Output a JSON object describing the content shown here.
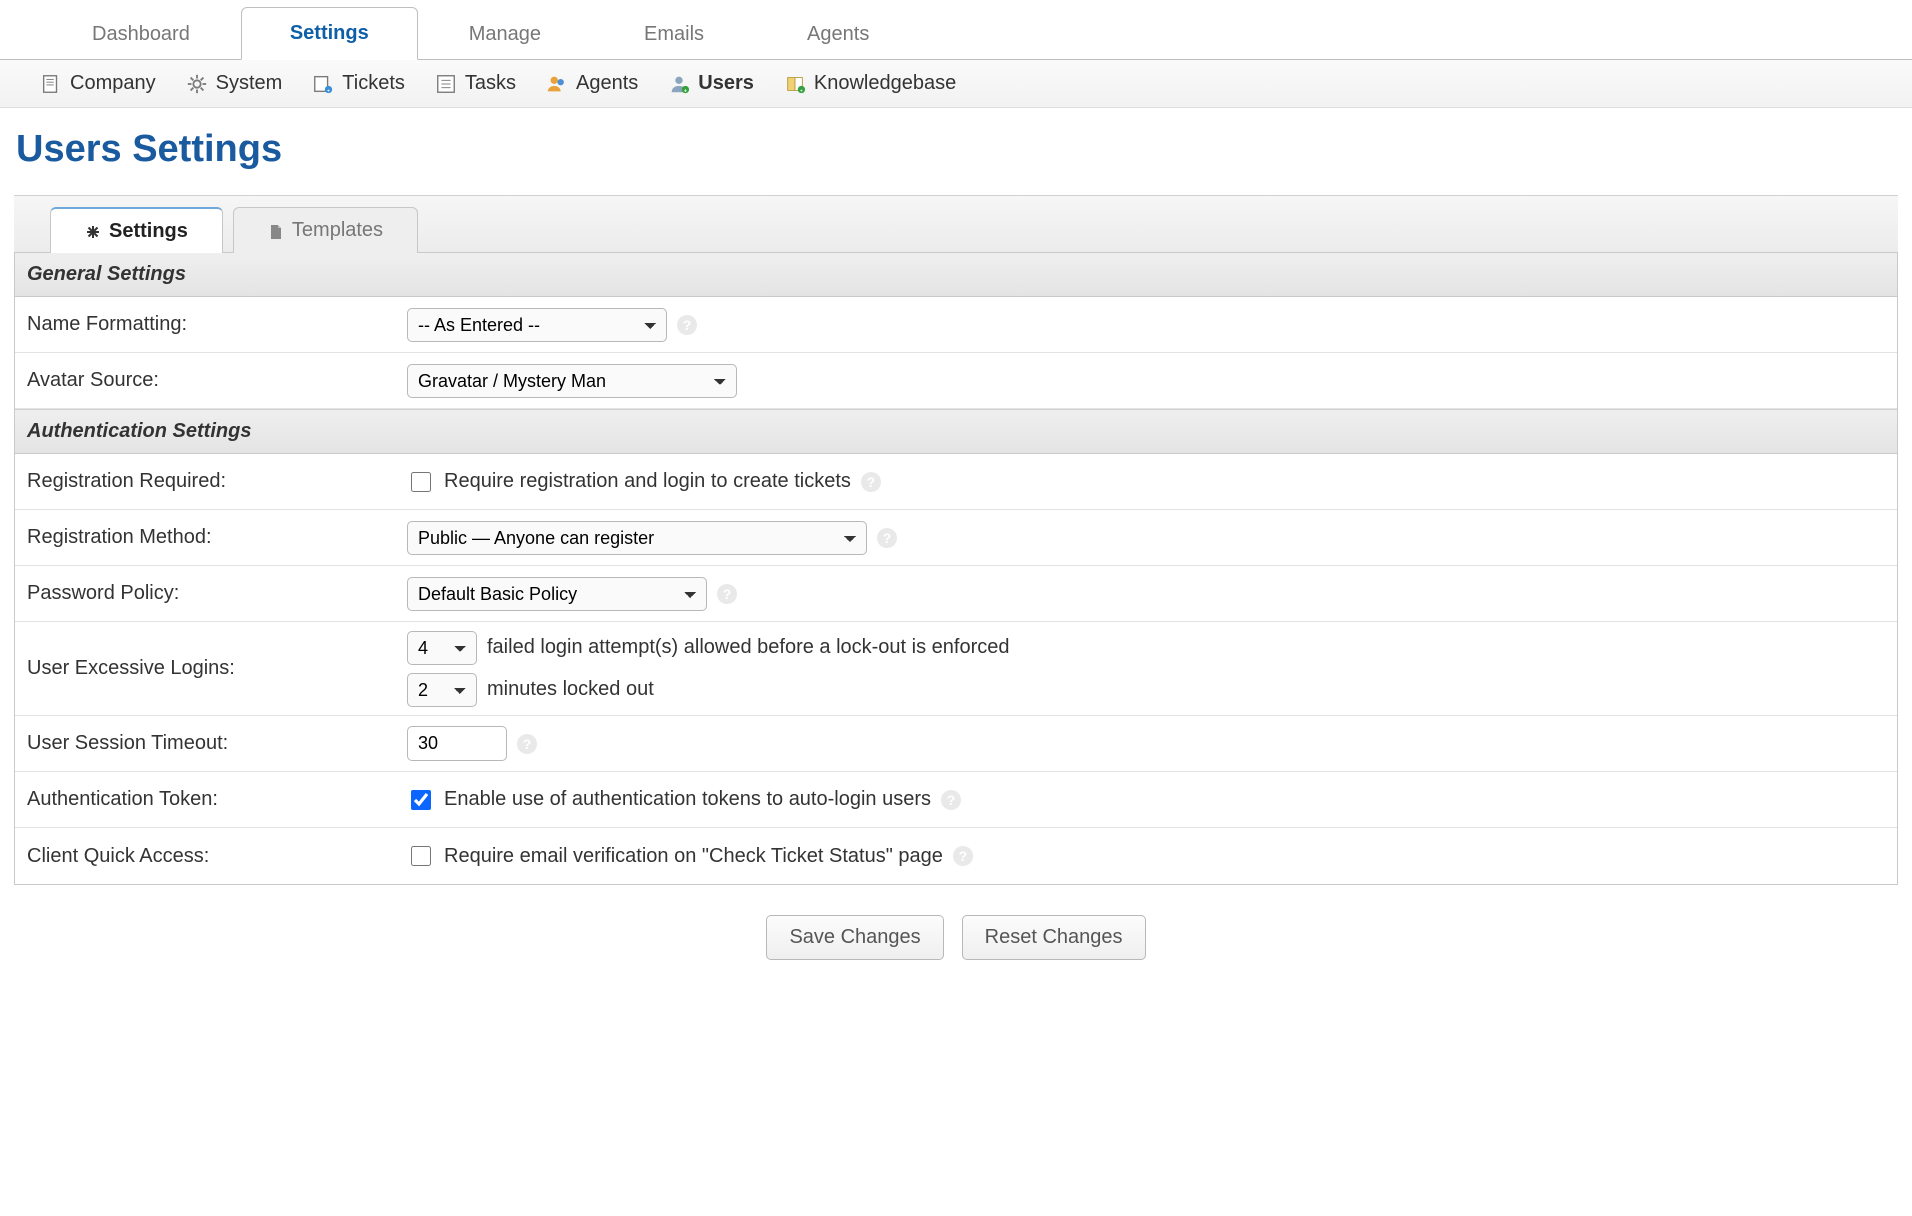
{
  "topnav": {
    "tabs": [
      {
        "label": "Dashboard",
        "active": false
      },
      {
        "label": "Settings",
        "active": true
      },
      {
        "label": "Manage",
        "active": false
      },
      {
        "label": "Emails",
        "active": false
      },
      {
        "label": "Agents",
        "active": false
      }
    ]
  },
  "subnav": {
    "items": [
      {
        "label": "Company",
        "active": false,
        "icon": "company-icon"
      },
      {
        "label": "System",
        "active": false,
        "icon": "gear-icon"
      },
      {
        "label": "Tickets",
        "active": false,
        "icon": "ticket-icon"
      },
      {
        "label": "Tasks",
        "active": false,
        "icon": "tasks-icon"
      },
      {
        "label": "Agents",
        "active": false,
        "icon": "agents-icon"
      },
      {
        "label": "Users",
        "active": true,
        "icon": "user-icon"
      },
      {
        "label": "Knowledgebase",
        "active": false,
        "icon": "book-icon"
      }
    ]
  },
  "page_title": "Users Settings",
  "content_tabs": [
    {
      "label": "Settings",
      "active": true,
      "icon": "asterisk-icon"
    },
    {
      "label": "Templates",
      "active": false,
      "icon": "file-icon"
    }
  ],
  "sections": {
    "general": {
      "header": "General Settings",
      "name_formatting": {
        "label": "Name Formatting:",
        "value": "-- As Entered --"
      },
      "avatar_source": {
        "label": "Avatar Source:",
        "value": "Gravatar / Mystery Man"
      }
    },
    "auth": {
      "header": "Authentication Settings",
      "registration_required": {
        "label": "Registration Required:",
        "checked": false,
        "text": "Require registration and login to create tickets"
      },
      "registration_method": {
        "label": "Registration Method:",
        "value": "Public — Anyone can register"
      },
      "password_policy": {
        "label": "Password Policy:",
        "value": "Default Basic Policy"
      },
      "excessive_logins": {
        "label": "User Excessive Logins:",
        "attempts": "4",
        "attempts_text": "failed login attempt(s) allowed before a lock-out is enforced",
        "lock_minutes": "2",
        "lock_text": "minutes locked out"
      },
      "session_timeout": {
        "label": "User Session Timeout:",
        "value": "30"
      },
      "auth_token": {
        "label": "Authentication Token:",
        "checked": true,
        "text": "Enable use of authentication tokens to auto-login users"
      },
      "quick_access": {
        "label": "Client Quick Access:",
        "checked": false,
        "text": "Require email verification on \"Check Ticket Status\" page"
      }
    }
  },
  "buttons": {
    "save": "Save Changes",
    "reset": "Reset Changes"
  }
}
